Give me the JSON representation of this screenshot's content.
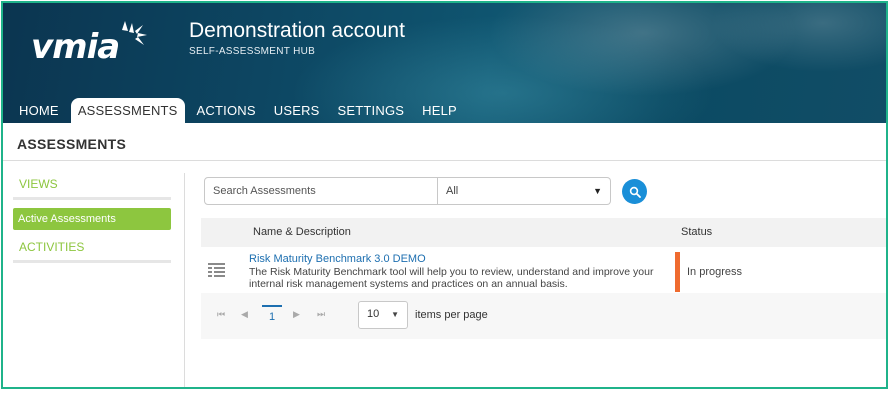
{
  "brand": {
    "logo_text": "vmia",
    "account_title": "Demonstration account",
    "hub_subtitle": "SELF-ASSESSMENT HUB"
  },
  "nav": {
    "items": [
      {
        "label": "HOME"
      },
      {
        "label": "ASSESSMENTS",
        "active": true
      },
      {
        "label": "ACTIONS"
      },
      {
        "label": "USERS"
      },
      {
        "label": "SETTINGS"
      },
      {
        "label": "HELP"
      }
    ]
  },
  "page": {
    "heading": "ASSESSMENTS"
  },
  "sidebar": {
    "views_label": "VIEWS",
    "active_item": "Active Assessments",
    "activities_label": "ACTIVITIES"
  },
  "filters": {
    "search_placeholder": "Search Assessments",
    "select_value": "All"
  },
  "table": {
    "columns": [
      "Name & Description",
      "Status"
    ],
    "rows": [
      {
        "name": "Risk Maturity Benchmark 3.0 DEMO",
        "description": "The Risk Maturity Benchmark tool will help you to review, understand and improve your internal risk management systems and practices on an annual basis.",
        "status": "In progress",
        "status_color": "#ef6b2f"
      }
    ]
  },
  "pager": {
    "current_page": "1",
    "per_page": "10",
    "per_page_label": "items per page"
  },
  "colors": {
    "accent_green": "#8dc63f",
    "link_blue": "#1d6fb0",
    "search_button": "#1a8fd8",
    "frame_border": "#1fb38a"
  }
}
